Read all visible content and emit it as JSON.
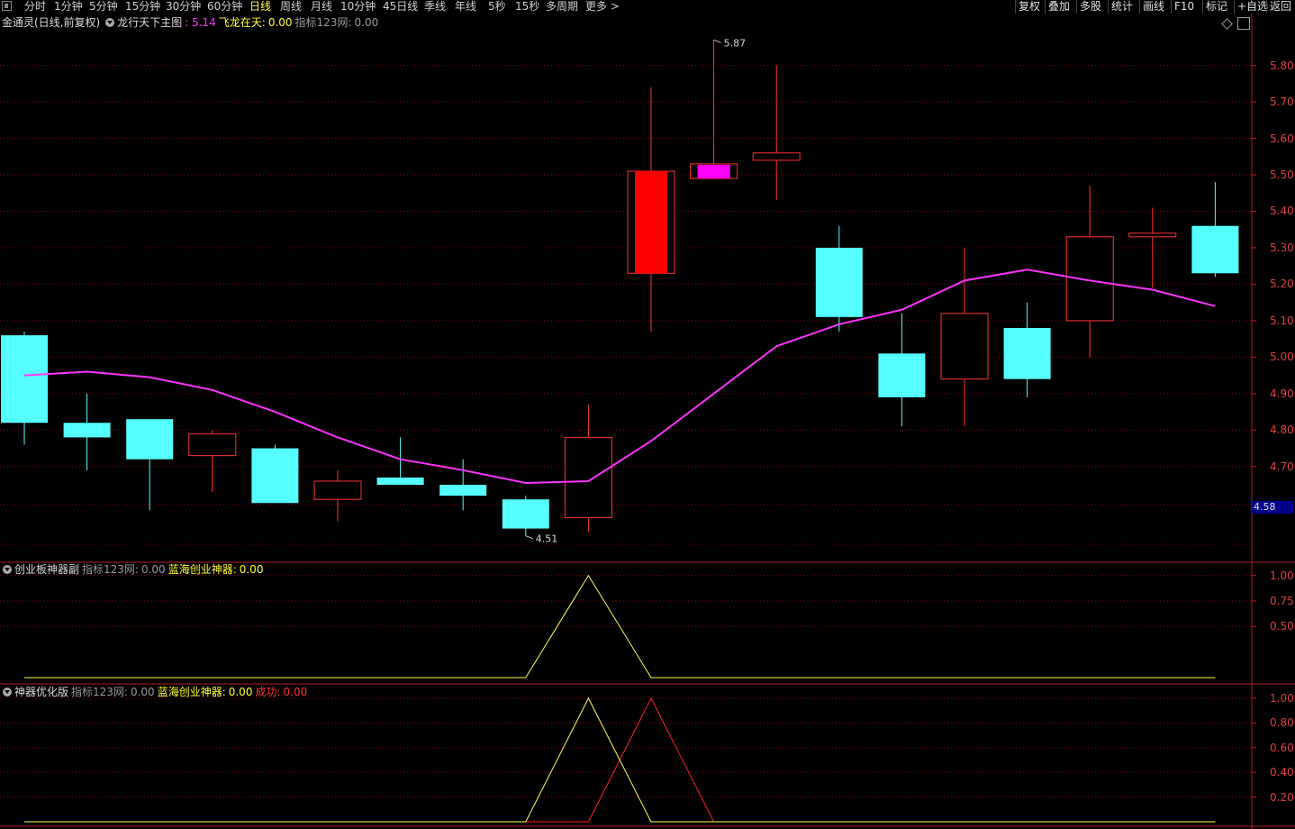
{
  "topbar": {
    "periods": [
      "分时",
      "1分钟",
      "5分钟",
      "15分钟",
      "30分钟",
      "60分钟",
      "日线",
      "周线",
      "月线",
      "10分钟",
      "45日线",
      "季线",
      "年线",
      "5秒",
      "15秒",
      "多周期",
      "更多 >"
    ],
    "active_period": "日线",
    "right_buttons": [
      "复权",
      "叠加",
      "多股",
      "统计",
      "画线",
      "F10",
      "标记",
      "+自选",
      "返回"
    ]
  },
  "main_panel": {
    "stock_label": "金通灵(日线,前复权)",
    "indicator_name": "龙行天下主图",
    "value1": ": 5.14",
    "label2": "飞龙在天:",
    "value2": "0.00",
    "label3": "指标123网:",
    "value3": "0.00",
    "y_labels": [
      "5.80",
      "5.70",
      "5.60",
      "5.50",
      "5.40",
      "5.30",
      "5.20",
      "5.10",
      "5.00",
      "4.90",
      "4.80",
      "4.70"
    ],
    "current_price": "4.58",
    "max_label": "5.87",
    "min_label": "4.51"
  },
  "sub_panel1": {
    "name": "创业板神器副",
    "label1": "指标123网:",
    "value1": "0.00",
    "label2": "蓝海创业神器:",
    "value2": "0.00",
    "y_labels": [
      "1.00",
      "0.75",
      "0.50"
    ]
  },
  "sub_panel2": {
    "name": "神器优化版",
    "label1": "指标123网:",
    "value1": "0.00",
    "label2": "蓝海创业神器:",
    "value2": "0.00",
    "label3": "成功:",
    "value3": "0.00",
    "y_labels": [
      "1.00",
      "0.80",
      "0.60",
      "0.40",
      "0.20"
    ]
  },
  "colors": {
    "up": "#ff3333",
    "down": "#55ffff",
    "ma": "#ff33ff",
    "grid": "#8b0000",
    "yellow": "#ffff55",
    "red": "#ff2222"
  },
  "chart_data": {
    "type": "candlestick",
    "candles": [
      {
        "o": 5.06,
        "h": 5.07,
        "l": 4.76,
        "c": 4.82,
        "dir": "down"
      },
      {
        "o": 4.82,
        "h": 4.9,
        "l": 4.69,
        "c": 4.78,
        "dir": "down"
      },
      {
        "o": 4.83,
        "h": 4.83,
        "l": 4.58,
        "c": 4.72,
        "dir": "down"
      },
      {
        "o": 4.73,
        "h": 4.8,
        "l": 4.63,
        "c": 4.79,
        "dir": "up"
      },
      {
        "o": 4.75,
        "h": 4.76,
        "l": 4.6,
        "c": 4.6,
        "dir": "down"
      },
      {
        "o": 4.61,
        "h": 4.69,
        "l": 4.55,
        "c": 4.66,
        "dir": "up"
      },
      {
        "o": 4.67,
        "h": 4.78,
        "l": 4.65,
        "c": 4.65,
        "dir": "down"
      },
      {
        "o": 4.65,
        "h": 4.72,
        "l": 4.58,
        "c": 4.62,
        "dir": "down"
      },
      {
        "o": 4.61,
        "h": 4.62,
        "l": 4.51,
        "c": 4.53,
        "dir": "down"
      },
      {
        "o": 4.56,
        "h": 4.87,
        "l": 4.52,
        "c": 4.78,
        "dir": "up"
      },
      {
        "o": 5.23,
        "h": 5.74,
        "l": 5.07,
        "c": 5.51,
        "dir": "up",
        "solid": true
      },
      {
        "o": 5.49,
        "h": 5.87,
        "l": 5.49,
        "c": 5.53,
        "dir": "up",
        "magenta": true
      },
      {
        "o": 5.54,
        "h": 5.8,
        "l": 5.43,
        "c": 5.56,
        "dir": "up"
      },
      {
        "o": 5.3,
        "h": 5.36,
        "l": 5.07,
        "c": 5.11,
        "dir": "down"
      },
      {
        "o": 5.01,
        "h": 5.12,
        "l": 4.81,
        "c": 4.89,
        "dir": "down"
      },
      {
        "o": 4.94,
        "h": 5.3,
        "l": 4.81,
        "c": 5.12,
        "dir": "up"
      },
      {
        "o": 5.08,
        "h": 5.15,
        "l": 4.89,
        "c": 4.94,
        "dir": "down"
      },
      {
        "o": 5.1,
        "h": 5.47,
        "l": 5.0,
        "c": 5.33,
        "dir": "up"
      },
      {
        "o": 5.33,
        "h": 5.41,
        "l": 5.19,
        "c": 5.34,
        "dir": "up"
      },
      {
        "o": 5.36,
        "h": 5.48,
        "l": 5.22,
        "c": 5.23,
        "dir": "down"
      }
    ],
    "ma": [
      4.95,
      4.96,
      4.945,
      4.91,
      4.85,
      4.78,
      4.72,
      4.69,
      4.655,
      4.66,
      4.77,
      4.9,
      5.03,
      5.09,
      5.13,
      5.21,
      5.24,
      5.21,
      5.185,
      5.14
    ],
    "ylim": [
      4.44,
      5.93
    ],
    "sub1": {
      "yellow": [
        0,
        0,
        0,
        0,
        0,
        0,
        0,
        0,
        0,
        1,
        0,
        0,
        0,
        0,
        0,
        0,
        0,
        0,
        0,
        0
      ],
      "ylim": [
        0,
        1.05
      ]
    },
    "sub2": {
      "yellow": [
        0,
        0,
        0,
        0,
        0,
        0,
        0,
        0,
        0,
        1,
        0,
        0,
        0,
        0,
        0,
        0,
        0,
        0,
        0,
        0
      ],
      "red": [
        0,
        0,
        0,
        0,
        0,
        0,
        0,
        0,
        0,
        0,
        1,
        0,
        0,
        0,
        0,
        0,
        0,
        0,
        0,
        0
      ],
      "ylim": [
        0,
        1.05
      ]
    }
  }
}
